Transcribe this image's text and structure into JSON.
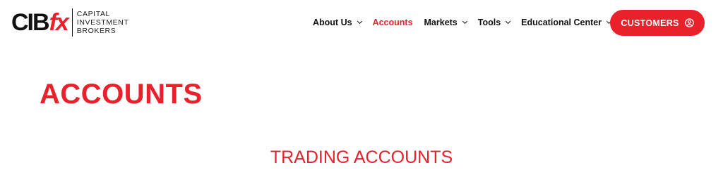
{
  "logo": {
    "mark_main": "CIB",
    "mark_accent": "fx",
    "tagline": [
      "CAPITAL",
      "INVESTMENT",
      "BROKERS"
    ]
  },
  "nav": {
    "items": [
      {
        "label": "About Us",
        "has_dropdown": true,
        "active": false
      },
      {
        "label": "Accounts",
        "has_dropdown": false,
        "active": true
      },
      {
        "label": "Markets",
        "has_dropdown": true,
        "active": false
      },
      {
        "label": "Tools",
        "has_dropdown": true,
        "active": false
      },
      {
        "label": "Educational Center",
        "has_dropdown": true,
        "active": false
      }
    ]
  },
  "cta": {
    "label": "CUSTOMERS",
    "icon": "user-circle-icon"
  },
  "main": {
    "page_title": "ACCOUNTS",
    "section_title": "TRADING ACCOUNTS"
  },
  "colors": {
    "accent": "#e8212b",
    "text": "#111111",
    "background": "#ffffff"
  }
}
